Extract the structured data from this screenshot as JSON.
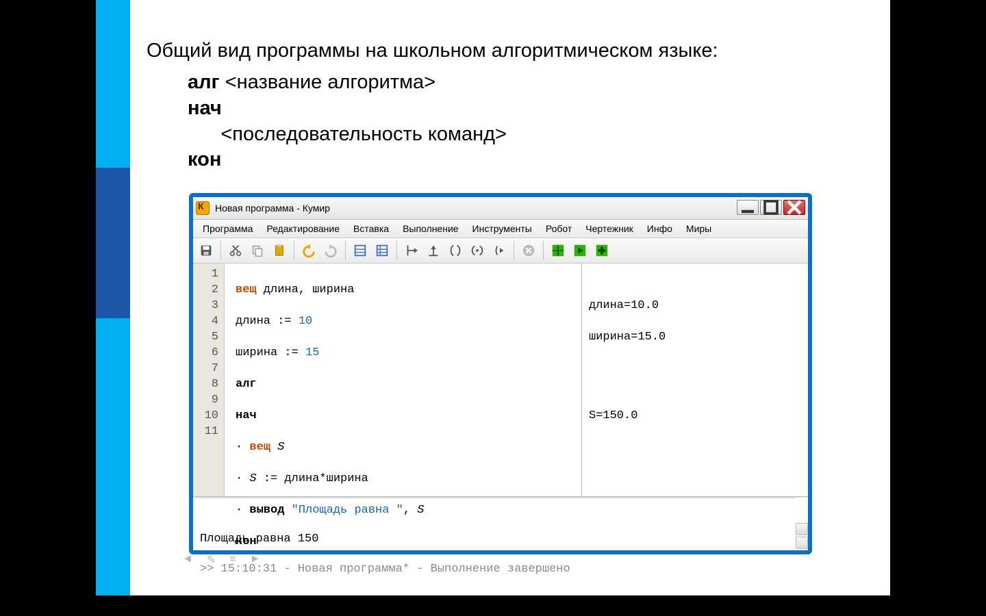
{
  "slide": {
    "title": "Общий вид программы на школьном алгоритмическом языке:",
    "template": {
      "line1_kw": "алг",
      "line1_rest": " <название алгоритма>",
      "line2_kw": "нач",
      "line3": "      <последовательность команд>",
      "line4_kw": "кон"
    }
  },
  "kumir": {
    "titlebar": "Новая программа - Кумир",
    "menu": [
      "Программа",
      "Редактирование",
      "Вставка",
      "Выполнение",
      "Инструменты",
      "Робот",
      "Чертежник",
      "Инфо",
      "Миры"
    ],
    "toolbar_icons": [
      "save-icon",
      "cut-icon",
      "copy-icon",
      "paste-icon",
      "undo-icon",
      "redo-icon",
      "table-small-icon",
      "table-list-icon",
      "debug-step-icon",
      "debug-step-out-icon",
      "brace-icon",
      "brace-pair-icon",
      "paren-step-icon",
      "stop-icon",
      "grid-green-icon",
      "grid-play-icon",
      "grid-plus-icon"
    ],
    "code_lines": {
      "l1": {
        "kw": "вещ",
        "rest": " длина, ширина"
      },
      "l2": {
        "pre": "длина := ",
        "num": "10"
      },
      "l3": {
        "pre": "ширина := ",
        "num": "15"
      },
      "l4": {
        "skw": "алг"
      },
      "l5": {
        "skw": "нач"
      },
      "l6": {
        "dot": "· ",
        "kw": "вещ",
        "id": " S"
      },
      "l7a": "· ",
      "l7id": "S",
      "l7b": " := длина*ширина",
      "l8": {
        "dot": "· ",
        "skw": "вывод ",
        "str": "\"Площадь равна \"",
        "rest": ", ",
        "id": "S"
      },
      "l9": {
        "skw": "кон"
      }
    },
    "gutter": [
      "1",
      "2",
      "3",
      "4",
      "5",
      "6",
      "7",
      "8",
      "9",
      "10",
      "11"
    ],
    "watch": {
      "w1": "",
      "w2": "длина=10.0",
      "w3": "ширина=15.0",
      "w4": "",
      "w5": "",
      "w6": "",
      "w7": "S=150.0"
    },
    "console": {
      "out": "Площадь равна 150",
      "log": ">> 15:10:31 - Новая программа* - Выполнение завершено"
    }
  }
}
